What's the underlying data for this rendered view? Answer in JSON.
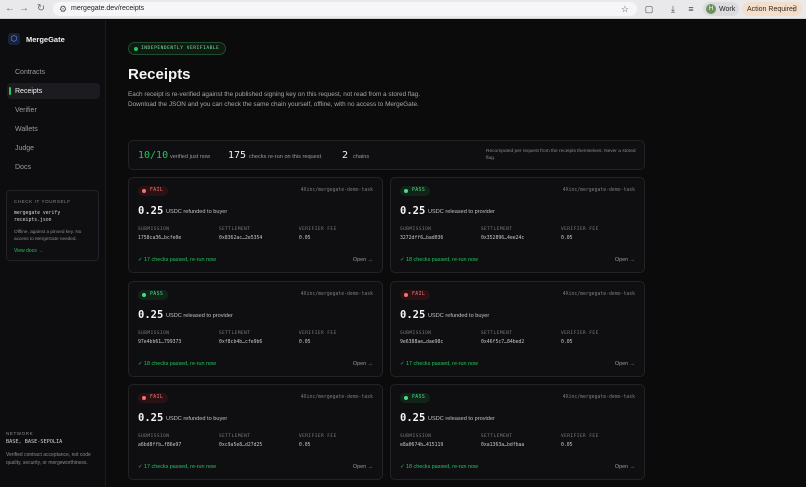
{
  "browser": {
    "url": "mergegate.dev/receipts",
    "profile_initial": "H",
    "profile_label": "Work",
    "action_label": "Action Required",
    "icons": [
      "back-icon",
      "forward-icon",
      "reload-icon",
      "site-settings-icon",
      "bookmark-star-icon",
      "extensions-icon",
      "downloads-icon",
      "tab-search-icon",
      "menu-icon"
    ]
  },
  "sidebar": {
    "brand": "MergeGate",
    "items": [
      {
        "label": "Contracts",
        "active": false
      },
      {
        "label": "Receipts",
        "active": true
      },
      {
        "label": "Verifier",
        "active": false
      },
      {
        "label": "Wallets",
        "active": false
      },
      {
        "label": "Judge",
        "active": false
      },
      {
        "label": "Docs",
        "active": false
      }
    ],
    "cli": {
      "title": "CHECK IT YOURSELF",
      "cmd_line1": "mergegate verify",
      "cmd_line2": "receipts.json",
      "note": "Offline, against a pinned key. No access to MergeGate needed.",
      "link": "View docs →"
    },
    "network": {
      "title": "NETWORK",
      "value": "BASE, BASE-SEPOLIA",
      "note": "Verified contract acceptance, not code quality, security, or mergeworthiness."
    }
  },
  "main": {
    "badge": "INDEPENDENTLY VERIFIABLE",
    "title": "Receipts",
    "intro": "Each receipt is re-verified against the published signing key on this request, not read from a stored flag. Download the JSON and you can check the same chain yourself, offline, with no access to MergeGate.",
    "stats": {
      "verified_value": "10/10",
      "verified_label": "verified just now",
      "checks_value": "175",
      "checks_label": "checks re-run on this request",
      "chains_value": "2",
      "chains_label": "chains",
      "note": "Recomputed per request from the receipts themselves. Never a stored flag."
    },
    "field_labels": {
      "submission": "SUBMISSION",
      "settlement": "SETTLEMENT",
      "fee": "VERIFIER FEE"
    },
    "open_label": "Open →",
    "receipts": [
      {
        "status": "FAIL",
        "repo": "4Xinc/mergegate-demo-task",
        "amount": "0.25",
        "desc": "USDC refunded to buyer",
        "submission": "1758ca36…bcfe0e",
        "settlement": "0x8362ac…2e5354",
        "fee": "0.05",
        "checks": "✓ 17 checks passed, re-run now"
      },
      {
        "status": "PASS",
        "repo": "4Xinc/mergegate-demo-task",
        "amount": "0.25",
        "desc": "USDC released to provider",
        "submission": "3272dff6…bad036",
        "settlement": "0x352896…4ee24c",
        "fee": "0.05",
        "checks": "✓ 18 checks passed, re-run now"
      },
      {
        "status": "PASS",
        "repo": "4Xinc/mergegate-demo-task",
        "amount": "0.25",
        "desc": "USDC released to provider",
        "submission": "97e4bb61…799373",
        "settlement": "0xf8cb4b…cfe9b6",
        "fee": "0.05",
        "checks": "✓ 18 checks passed, re-run now"
      },
      {
        "status": "FAIL",
        "repo": "4Xinc/mergegate-demo-task",
        "amount": "0.25",
        "desc": "USDC refunded to buyer",
        "submission": "9e6388ae…dae98c",
        "settlement": "0x46f5c7…84bed2",
        "fee": "0.05",
        "checks": "✓ 17 checks passed, re-run now"
      },
      {
        "status": "FAIL",
        "repo": "4Xinc/mergegate-demo-task",
        "amount": "0.25",
        "desc": "USDC refunded to buyer",
        "submission": "a6bd8ffb…f86e97",
        "settlement": "0xc9a5e8…d27d25",
        "fee": "0.05",
        "checks": "✓ 17 checks passed, re-run now"
      },
      {
        "status": "PASS",
        "repo": "4Xinc/mergegate-demo-task",
        "amount": "0.25",
        "desc": "USDC released to provider",
        "submission": "e8a0674b…415119",
        "settlement": "0xa1363a…bdfbaa",
        "fee": "0.05",
        "checks": "✓ 18 checks passed, re-run now"
      }
    ]
  },
  "colors": {
    "accent": "#22c55e",
    "fail": "#f87171",
    "background": "#0b0b0c"
  }
}
